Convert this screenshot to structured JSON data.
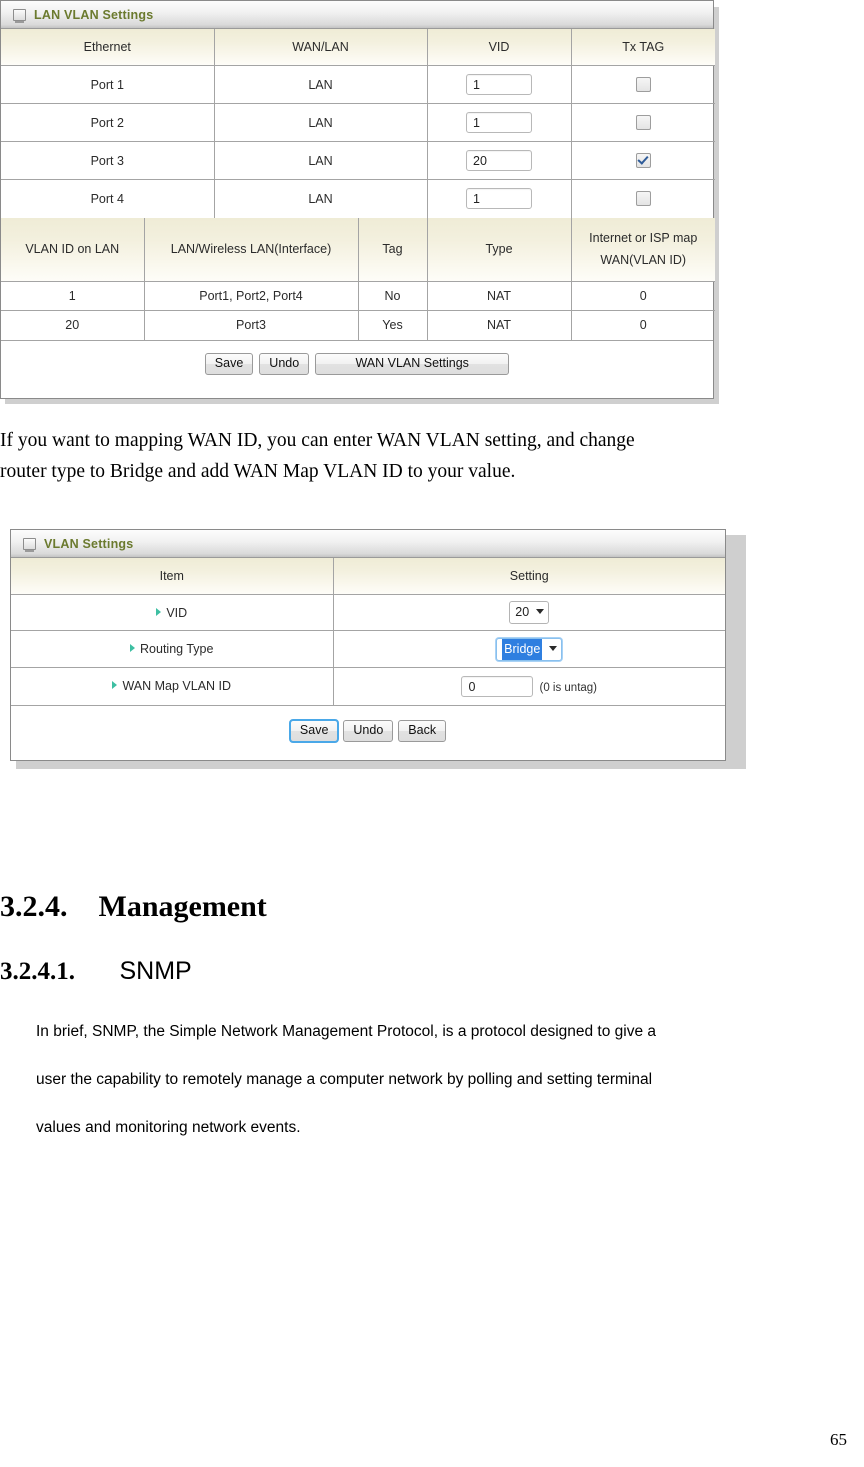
{
  "page": {
    "number": "65"
  },
  "lan_vlan_panel": {
    "title": "LAN VLAN Settings",
    "port_table": {
      "headers": [
        "Ethernet",
        "WAN/LAN",
        "VID",
        "Tx TAG"
      ],
      "rows": [
        {
          "ethernet": "Port 1",
          "wanlan": "LAN",
          "vid": "1",
          "tx_tag": false
        },
        {
          "ethernet": "Port 2",
          "wanlan": "LAN",
          "vid": "1",
          "tx_tag": false
        },
        {
          "ethernet": "Port 3",
          "wanlan": "LAN",
          "vid": "20",
          "tx_tag": true
        },
        {
          "ethernet": "Port 4",
          "wanlan": "LAN",
          "vid": "1",
          "tx_tag": false
        }
      ]
    },
    "summary_table": {
      "headers": [
        "VLAN ID on LAN",
        "LAN/Wireless LAN(Interface)",
        "Tag",
        "Type",
        "Internet or ISP map"
      ],
      "header_last_line2": "WAN(VLAN ID)",
      "rows": [
        {
          "vlan_id": "1",
          "interface": "Port1, Port2, Port4",
          "tag": "No",
          "type": "NAT",
          "isp_map": "0"
        },
        {
          "vlan_id": "20",
          "interface": "Port3",
          "tag": "Yes",
          "type": "NAT",
          "isp_map": "0"
        }
      ]
    },
    "buttons": {
      "save": "Save",
      "undo": "Undo",
      "wan_vlan_settings": "WAN VLAN Settings"
    }
  },
  "body_text_1": {
    "line1": "If you want to mapping WAN ID, you can enter WAN VLAN setting, and change",
    "line2": "router type to Bridge and add WAN Map VLAN ID to your value."
  },
  "vlan_settings_panel": {
    "title": "VLAN Settings",
    "headers": [
      "Item",
      "Setting"
    ],
    "rows": [
      {
        "item": "VID",
        "control": "select",
        "value": "20",
        "highlighted": false
      },
      {
        "item": "Routing Type",
        "control": "select",
        "value": "Bridge",
        "highlighted": true
      },
      {
        "item": "WAN Map VLAN ID",
        "control": "text",
        "value": "0",
        "hint": "(0 is untag)"
      }
    ],
    "buttons": {
      "save": "Save",
      "undo": "Undo",
      "back": "Back"
    }
  },
  "headings": {
    "section_number": "3.2.4.",
    "section_title": "Management",
    "subsection_number": "3.2.4.1.",
    "subsection_title": "SNMP"
  },
  "snmp_paragraph": {
    "line1": "In brief, SNMP, the Simple Network Management Protocol, is a protocol designed to give a",
    "line2": "user the capability to remotely manage a computer network by polling and setting terminal",
    "line3": "values and monitoring network events."
  },
  "colors": {
    "panel_title": "#6b7a2e",
    "header_gradient_top": "#efecd6",
    "bullet": "#3dbfa2",
    "select_highlight": "#2f7fe0",
    "focus_ring": "#4aa8e8"
  }
}
